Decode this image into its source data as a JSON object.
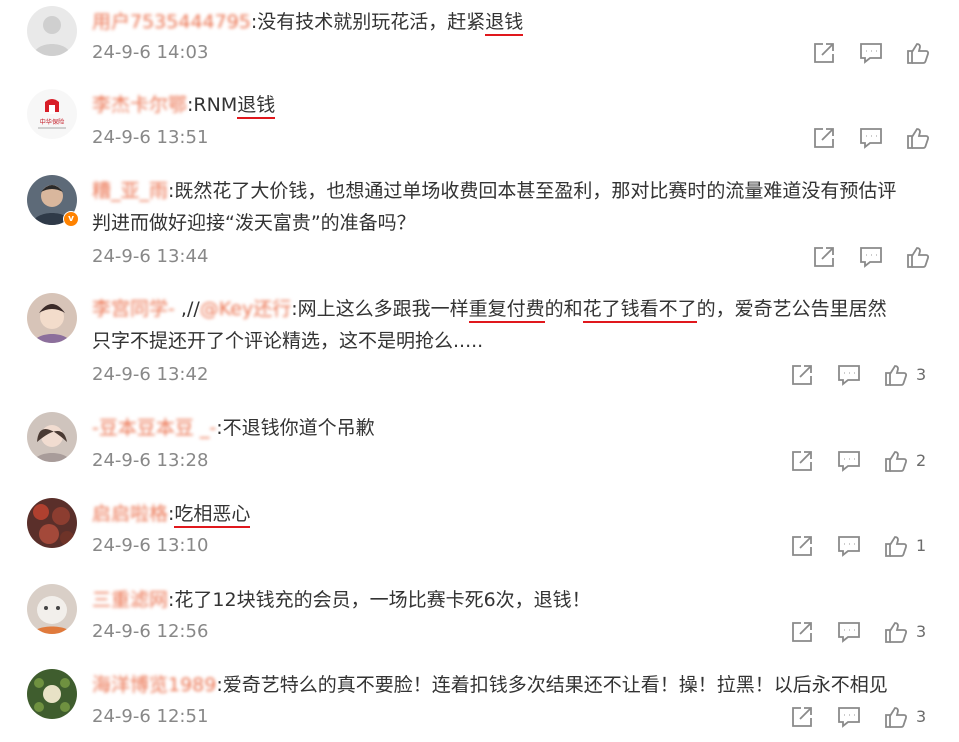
{
  "colors": {
    "username": "#eb7350",
    "timestamp": "#888888",
    "underline": "#e0181d",
    "icon": "#8a8a8a",
    "verified_badge": "#ff8200"
  },
  "icons": [
    "share-icon",
    "comment-icon",
    "like-icon"
  ],
  "comments": [
    {
      "username": "用户7535444795",
      "text_segments": [
        ":没有技术就别玩花活，赶紧",
        "退钱"
      ],
      "timestamp": "24-9-6 14:03",
      "likes": ""
    },
    {
      "username": "李杰卡尔鄂",
      "avatar_logo": "中华保险",
      "text_segments": [
        ":RNM",
        "退钱"
      ],
      "timestamp": "24-9-6 13:51",
      "likes": ""
    },
    {
      "username": "糟_亚_雨",
      "text_lines": [
        ":既然花了大价钱，也想通过单场收费回本甚至盈利，那对比赛时的流量难道没有预估评",
        "判进而做好迎接“泼天富贵”的准备吗？"
      ],
      "timestamp": "24-9-6 13:44",
      "likes": ""
    },
    {
      "username": "李宫同学- ",
      "mention": "@Key还行",
      "text_segments": [
        ":网上这么多跟我一样",
        "重复付费",
        "的和",
        "花了钱看不了",
        "的，爱奇艺公告里居然"
      ],
      "text_line2": "只字不提还开了个评论精选，这不是明抢么.....",
      "timestamp": "24-9-6 13:42",
      "likes": "3"
    },
    {
      "username": "-豆本豆本豆 _-",
      "text": ":不退钱你道个吊歉",
      "timestamp": "24-9-6 13:28",
      "likes": "2"
    },
    {
      "username": "启启啦格",
      "text_segments": [
        ":",
        "吃相恶心"
      ],
      "timestamp": "24-9-6 13:10",
      "likes": "1"
    },
    {
      "username": "三重滤网",
      "text": ":花了12块钱充的会员，一场比赛卡死6次，退钱！",
      "timestamp": "24-9-6 12:56",
      "likes": "3"
    },
    {
      "username": "海洋博览1989",
      "text": ":爱奇艺特么的真不要脸！连着扣钱多次结果还不让看！操！拉黑！以后永不相见",
      "timestamp": "24-9-6 12:51",
      "likes": "3"
    }
  ]
}
